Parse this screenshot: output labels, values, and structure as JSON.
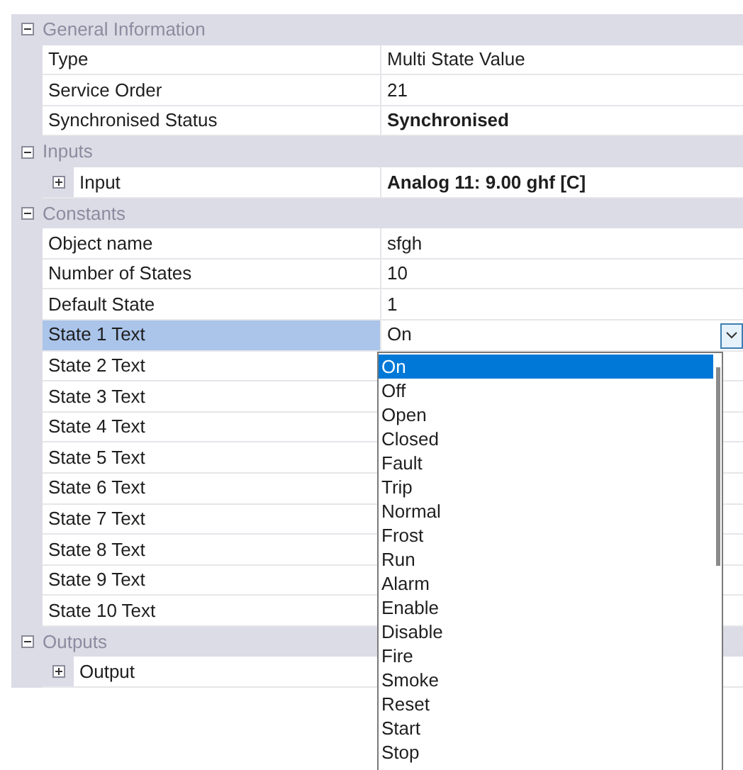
{
  "categories": [
    {
      "title": "General Information",
      "expanded": true,
      "properties": [
        {
          "name": "Type",
          "value": "Multi State Value",
          "bold": false,
          "selected": false
        },
        {
          "name": "Service Order",
          "value": "21",
          "bold": false,
          "selected": false
        },
        {
          "name": "Synchronised Status",
          "value": "Synchronised",
          "bold": true,
          "selected": false
        }
      ]
    },
    {
      "title": "Inputs",
      "expanded": true,
      "properties": [
        {
          "name": "Input",
          "value": "Analog 11: 9.00 ghf [C]",
          "bold": true,
          "selected": false,
          "expanded": false
        }
      ]
    },
    {
      "title": "Constants",
      "expanded": true,
      "properties": [
        {
          "name": "Object name",
          "value": "sfgh",
          "bold": false,
          "selected": false
        },
        {
          "name": "Number of States",
          "value": "10",
          "bold": false,
          "selected": false
        },
        {
          "name": "Default State",
          "value": "1",
          "bold": false,
          "selected": false
        },
        {
          "name": "State 1 Text",
          "value": "On",
          "bold": false,
          "selected": true
        },
        {
          "name": "State 2 Text",
          "selected": false
        },
        {
          "name": "State 3 Text",
          "selected": false
        },
        {
          "name": "State 4 Text",
          "selected": false
        },
        {
          "name": "State 5 Text",
          "selected": false
        },
        {
          "name": "State 6 Text",
          "selected": false
        },
        {
          "name": "State 7 Text",
          "selected": false
        },
        {
          "name": "State 8 Text",
          "selected": false
        },
        {
          "name": "State 9 Text",
          "selected": false
        },
        {
          "name": "State 10 Text",
          "selected": false
        }
      ]
    },
    {
      "title": "Outputs",
      "expanded": true,
      "properties": [
        {
          "name": "Output",
          "selected": false,
          "expanded": false
        }
      ]
    }
  ],
  "dropdown": {
    "items": [
      {
        "label": "On",
        "selected": true
      },
      {
        "label": "Off",
        "selected": false
      },
      {
        "label": "Open",
        "selected": false
      },
      {
        "label": "Closed",
        "selected": false
      },
      {
        "label": "Fault",
        "selected": false
      },
      {
        "label": "Trip",
        "selected": false
      },
      {
        "label": "Normal",
        "selected": false
      },
      {
        "label": "Frost",
        "selected": false
      },
      {
        "label": "Run",
        "selected": false
      },
      {
        "label": "Alarm",
        "selected": false
      },
      {
        "label": "Enable",
        "selected": false
      },
      {
        "label": "Disable",
        "selected": false
      },
      {
        "label": "Fire",
        "selected": false
      },
      {
        "label": "Smoke",
        "selected": false
      },
      {
        "label": "Reset",
        "selected": false
      },
      {
        "label": "Start",
        "selected": false
      },
      {
        "label": "Stop",
        "selected": false
      }
    ]
  }
}
